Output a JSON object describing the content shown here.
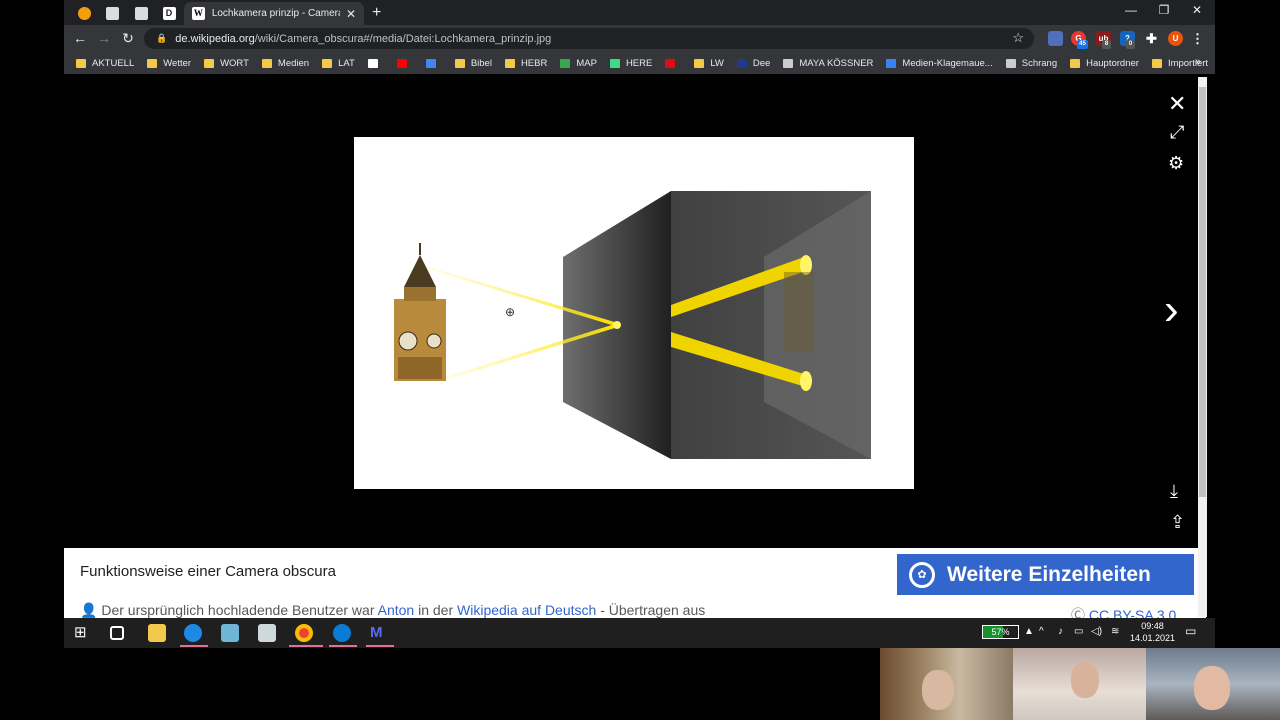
{
  "browser": {
    "active_tab_title": "Lochkamera prinzip - Camera obscura",
    "address_domain": "de.wikipedia.org",
    "address_path": "/wiki/Camera_obscura#/media/Datei:Lochkamera_prinzip.jpg",
    "extension_badges": [
      "45",
      "8",
      "0"
    ],
    "profile_initial": "U"
  },
  "bookmarks": [
    {
      "label": "AKTUELL",
      "color": "#f2c94c"
    },
    {
      "label": "Wetter",
      "color": "#f2c94c"
    },
    {
      "label": "WORT",
      "color": "#f2c94c"
    },
    {
      "label": "Medien",
      "color": "#f2c94c"
    },
    {
      "label": "LAT",
      "color": "#f2c94c"
    },
    {
      "label": "",
      "color": "#ffffff"
    },
    {
      "label": "",
      "color": "#ff0000"
    },
    {
      "label": "",
      "color": "#4285f4"
    },
    {
      "label": "Bibel",
      "color": "#f2c94c"
    },
    {
      "label": "HEBR",
      "color": "#f2c94c"
    },
    {
      "label": "MAP",
      "color": "#34a853"
    },
    {
      "label": "HERE",
      "color": "#3ddc84"
    },
    {
      "label": "",
      "color": "#e50914"
    },
    {
      "label": "LW",
      "color": "#f2c94c"
    },
    {
      "label": "Dee",
      "color": "#1e3a8a"
    },
    {
      "label": "MAYA KÖSSNER",
      "color": "#cccccc"
    },
    {
      "label": "Medien-Klagemaue...",
      "color": "#3b82f6"
    },
    {
      "label": "Schrang",
      "color": "#cccccc"
    },
    {
      "label": "Hauptordner",
      "color": "#f2c94c"
    },
    {
      "label": "Importiert",
      "color": "#f2c94c"
    }
  ],
  "viewer": {
    "caption": "Funktionsweise einer Camera obscura",
    "details_button": "Weitere Einzelheiten",
    "uploader_prefix": "Der ursprünglich hochladende Benutzer war ",
    "uploader_user": "Anton",
    "uploader_mid": " in der ",
    "uploader_wiki": "Wikipedia auf Deutsch",
    "uploader_suffix": " - Übertragen aus",
    "license": "CC BY-SA 3.0"
  },
  "taskbar": {
    "battery": "57%",
    "battery_level": 0.57,
    "time": "09:48",
    "date": "14.01.2021"
  }
}
